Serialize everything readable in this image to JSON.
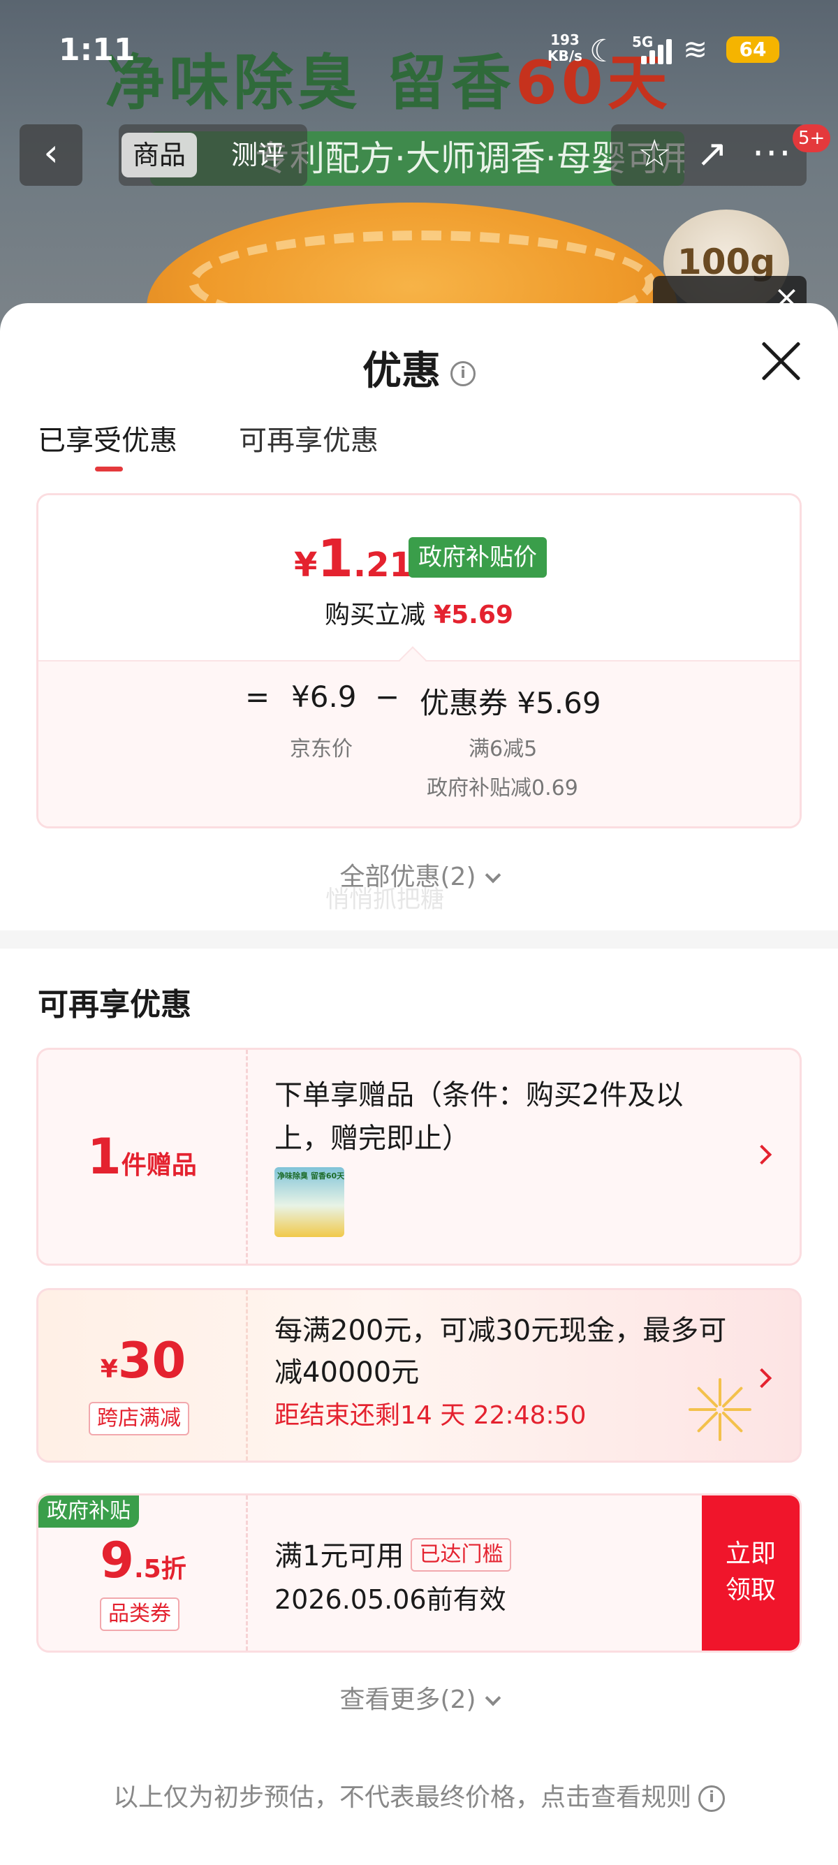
{
  "status_bar": {
    "time": "1:11",
    "net_speed_value": "193",
    "net_speed_unit": "KB/s",
    "network": "5G",
    "battery": "64"
  },
  "product_bg": {
    "headline_green": "净味除臭 留香",
    "headline_red": "60天",
    "strip": "专利配方·大师调香·母婴可用",
    "badge": "100g"
  },
  "nav": {
    "tabs": [
      "商品",
      "测评"
    ],
    "cart_badge": "5+"
  },
  "sheet": {
    "title": "优惠",
    "tabs": [
      "已享受优惠",
      "可再享优惠"
    ],
    "price": {
      "currency": "¥",
      "integer": "1",
      "decimal": ".21",
      "tag": "政府补贴价"
    },
    "instant": {
      "label": "购买立减",
      "amount": "¥5.69"
    },
    "formula": {
      "eq": "=",
      "jd_price": "¥6.9",
      "minus": "−",
      "coupon": "优惠券 ¥5.69",
      "jd_label": "京东价",
      "coupon_rule": "满6减5",
      "gov_sub": "政府补贴减0.69"
    },
    "all_coupons": "全部优惠(2)",
    "watermark": "悄悄抓把糖",
    "section2_title": "可再享优惠",
    "card1": {
      "num": "1",
      "unit": "件赠品",
      "desc": "下单享赠品（条件：购买2件及以上，赠完即止）",
      "thumb_text": "净味除臭 留香60天"
    },
    "card2": {
      "currency": "¥",
      "amount": "30",
      "tag": "跨店满减",
      "desc": "每满200元，可减30元现金，最多可减40000元",
      "countdown": "距结束还剩14 天 22:48:50"
    },
    "card3": {
      "gov_badge": "政府补贴",
      "discount_num": "9",
      "discount_suffix": ".5折",
      "tag": "品类券",
      "line1": "满1元可用",
      "threshold": "已达门槛",
      "line2": "2026.05.06前有效",
      "claim1": "立即",
      "claim2": "领取"
    },
    "more": "查看更多(2)",
    "disclaimer": "以上仅为初步预估，不代表最终价格，点击查看规则"
  }
}
